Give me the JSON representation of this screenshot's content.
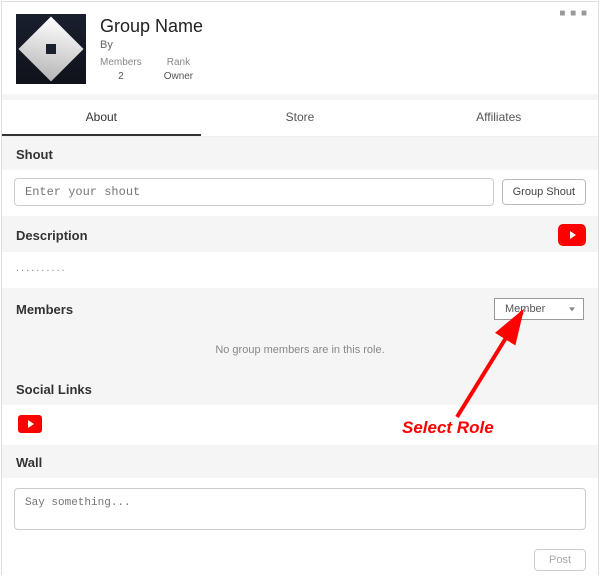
{
  "header": {
    "title": "Group Name",
    "by_label": "By",
    "stats": {
      "members_label": "Members",
      "members_value": "2",
      "rank_label": "Rank",
      "rank_value": "Owner"
    }
  },
  "tabs": {
    "about": "About",
    "store": "Store",
    "affiliates": "Affiliates"
  },
  "shout": {
    "label": "Shout",
    "placeholder": "Enter your shout",
    "button": "Group Shout"
  },
  "description": {
    "label": "Description",
    "text": ".........."
  },
  "members": {
    "label": "Members",
    "role_selected": "Member",
    "empty_text": "No group members are in this role."
  },
  "social": {
    "label": "Social Links"
  },
  "wall": {
    "label": "Wall",
    "placeholder": "Say something...",
    "post_button": "Post"
  },
  "annotation": {
    "text": "Select Role"
  }
}
